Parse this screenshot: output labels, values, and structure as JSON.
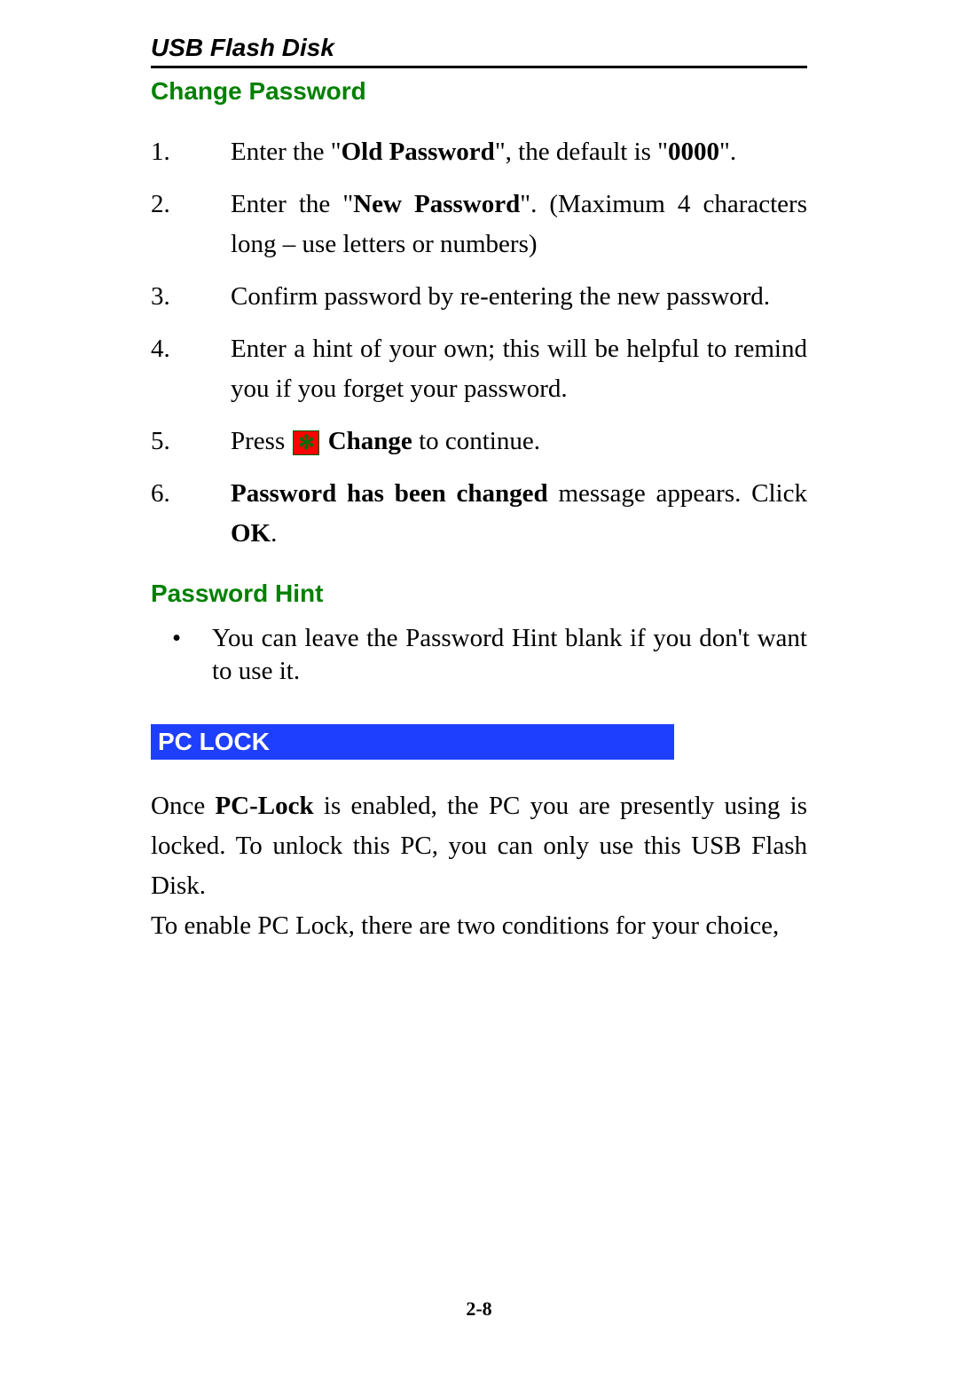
{
  "header": {
    "title": "USB Flash Disk"
  },
  "changePassword": {
    "heading": "Change Password",
    "step1_pre": "Enter the \"",
    "step1_bold": "Old Password",
    "step1_mid": "\", the default is \"",
    "step1_bold2": "0000",
    "step1_post": "\".",
    "step2_pre": "Enter the \"",
    "step2_bold": "New Password",
    "step2_post": "\". (Maximum 4 characters long – use letters or numbers)",
    "step3": "Confirm password by re-entering the new password.",
    "step4": "Enter a hint of your own; this will be helpful to remind you if you forget your password.",
    "step5_pre": "Press ",
    "step5_bold": " Change",
    "step5_post": " to continue.",
    "step6_bold": "Password has been changed",
    "step6_mid": " message appears. Click ",
    "step6_bold2": "OK",
    "step6_post": "."
  },
  "passwordHint": {
    "heading": "Password Hint",
    "item1": "You can leave the Password Hint blank if you don't want to use it."
  },
  "pcLock": {
    "heading": "PC LOCK",
    "para1_pre": "Once ",
    "para1_bold": "PC-Lock",
    "para1_post": " is enabled, the PC you are presently using is locked. To unlock this PC, you can only use this USB Flash Disk.",
    "para2": "To enable PC Lock, there are two conditions for your choice,"
  },
  "pageNumber": "2-8"
}
